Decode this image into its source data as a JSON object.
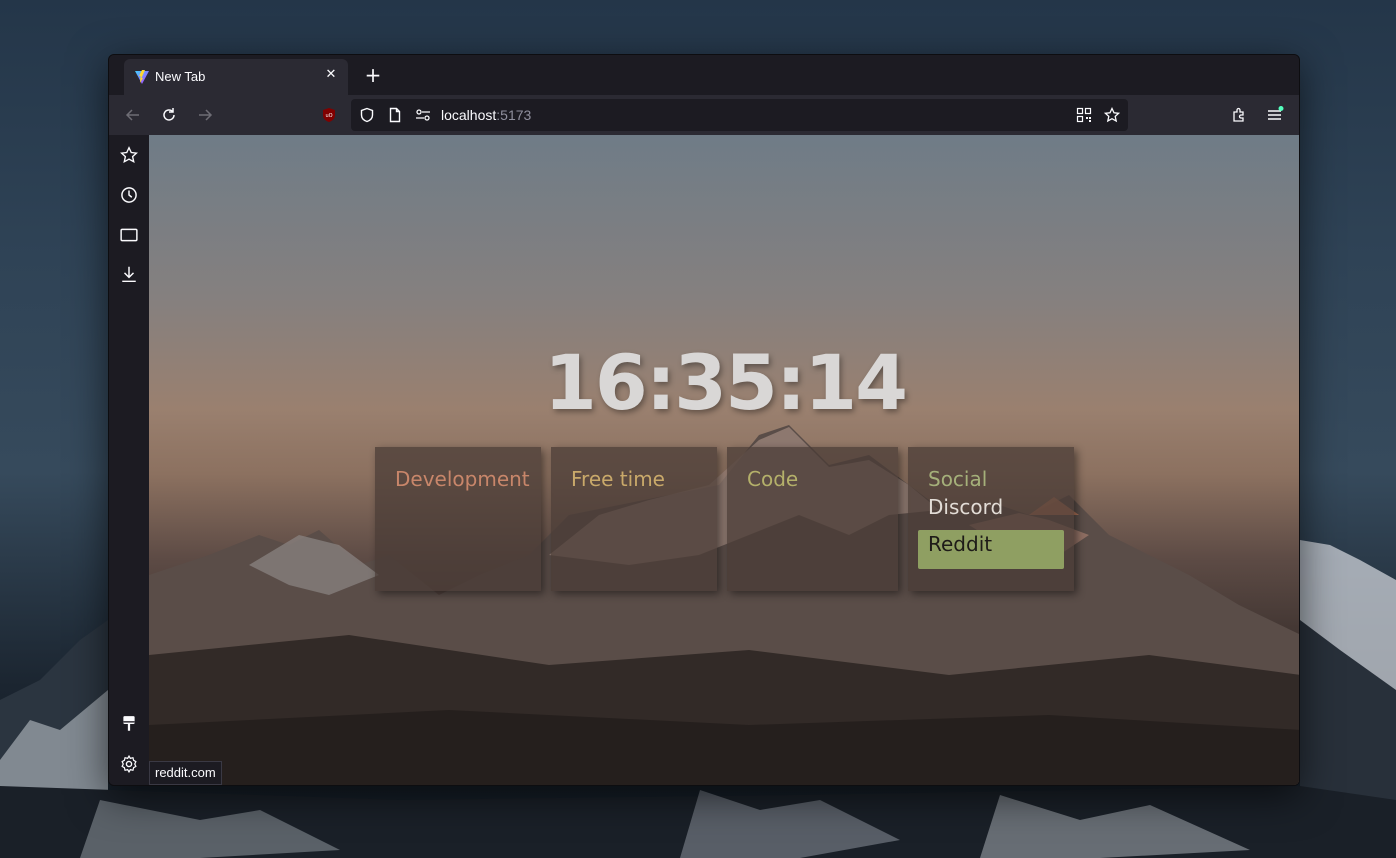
{
  "colors": {
    "development_title": "#c8866a",
    "freetime_title": "#c9a96a",
    "code_title": "#b4b06a",
    "social_title": "#a5b07a",
    "active_link_bg": "#8f9f62"
  },
  "browser": {
    "tab": {
      "title": "New Tab",
      "favicon": "vite-logo-icon",
      "close_label": "✕"
    },
    "new_tab_label": "+",
    "url": {
      "host": "localhost",
      "port": ":5173"
    },
    "toolbar_icons": [
      "back-icon",
      "reload-icon",
      "forward-icon",
      "ublock-icon",
      "shield-icon",
      "page-icon",
      "permissions-icon",
      "qr-code-icon",
      "bookmark-star-icon",
      "extensions-icon",
      "menu-icon"
    ],
    "sidebar_icons": [
      "bookmarks-icon",
      "history-icon",
      "tabs-icon",
      "downloads-icon",
      "customize-icon",
      "settings-icon"
    ],
    "status_text": "reddit.com"
  },
  "page": {
    "clock": "16:35:14",
    "cards": [
      {
        "title": "Development",
        "links": []
      },
      {
        "title": "Free time",
        "links": []
      },
      {
        "title": "Code",
        "links": []
      },
      {
        "title": "Social",
        "links": [
          "Discord",
          "Reddit"
        ],
        "active_link": "Reddit"
      }
    ]
  }
}
